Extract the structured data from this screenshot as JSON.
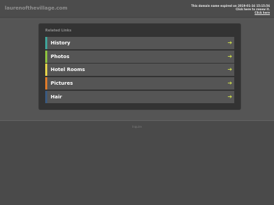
{
  "header": {
    "domain": "laurenofthevillage.com",
    "notice_line1": "This domain name expired on 2019-01-16 15:15:56",
    "notice_line2": "Click here to renew it.",
    "notice_line3": "Click here"
  },
  "panel": {
    "title": "Related Links",
    "links": [
      {
        "label": "History",
        "accent": "#3fa59a",
        "arrow": "➔"
      },
      {
        "label": "Photos",
        "accent": "#8fc43f",
        "arrow": "➔"
      },
      {
        "label": "Hotel Rooms",
        "accent": "#e5d44a",
        "arrow": "➔"
      },
      {
        "label": "Pictures",
        "accent": "#e07b2a",
        "arrow": "➔"
      },
      {
        "label": "Hair",
        "accent": "#3a5a80",
        "arrow": "➔"
      }
    ]
  },
  "footer": {
    "link": "Inquire"
  },
  "colors": {
    "page_bg": "#4a4a4a",
    "panel_bg": "#333333",
    "row_bg": "#555555",
    "arrow": "#cfe04a"
  }
}
